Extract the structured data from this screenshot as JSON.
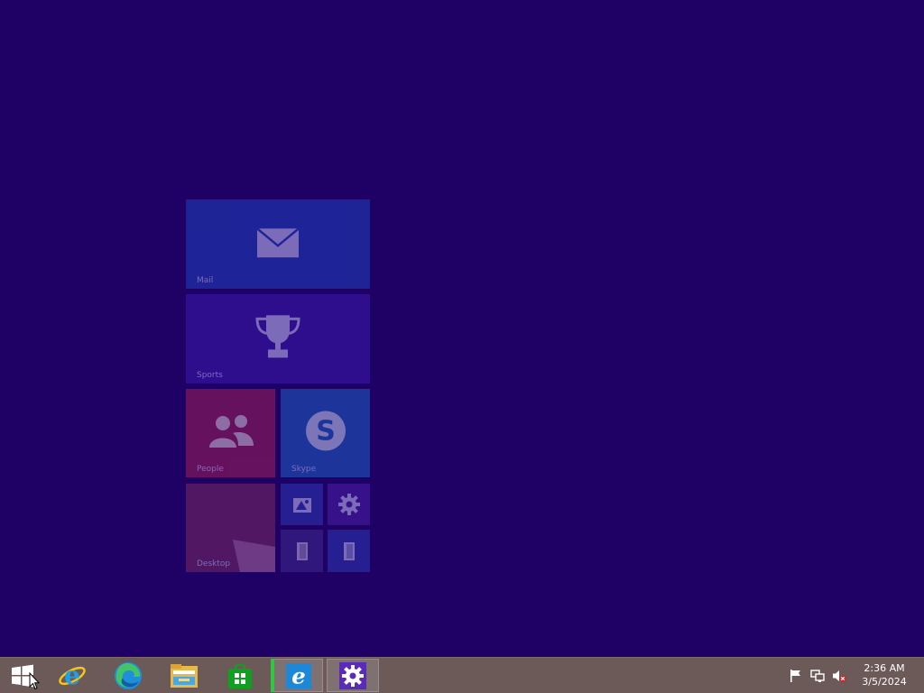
{
  "tiles": {
    "mail": {
      "label": "Mail",
      "icon": "mail-icon"
    },
    "sports": {
      "label": "Sports",
      "icon": "trophy-icon"
    },
    "people": {
      "label": "People",
      "icon": "people-icon"
    },
    "skype": {
      "label": "Skype",
      "icon": "skype-icon"
    },
    "desktop": {
      "label": "Desktop",
      "icon": "desktop-wallpaper"
    },
    "small": [
      {
        "icon": "photos-icon"
      },
      {
        "icon": "settings-gear-icon"
      },
      {
        "icon": "file-explorer-icon"
      },
      {
        "icon": "documents-icon"
      }
    ]
  },
  "taskbar": {
    "start": {
      "icon": "windows-logo-icon"
    },
    "pinned": [
      {
        "name": "Internet Explorer",
        "icon": "internet-explorer-icon"
      },
      {
        "name": "Microsoft Edge",
        "icon": "edge-icon"
      },
      {
        "name": "File Explorer",
        "icon": "file-explorer-icon"
      },
      {
        "name": "Store",
        "icon": "store-icon"
      }
    ],
    "running": [
      {
        "name": "Internet Explorer",
        "icon": "internet-explorer-icon",
        "active": true
      },
      {
        "name": "Settings",
        "icon": "settings-gear-icon",
        "active": false
      }
    ],
    "tray": {
      "icons": [
        "action-center-flag-icon",
        "network-icon",
        "volume-muted-icon"
      ],
      "time": "2:36 AM",
      "date": "3/5/2024"
    }
  },
  "colors": {
    "desktop_background": "#1f0065",
    "taskbar": "#6b5a58",
    "running_indicator": "#2ec740"
  }
}
